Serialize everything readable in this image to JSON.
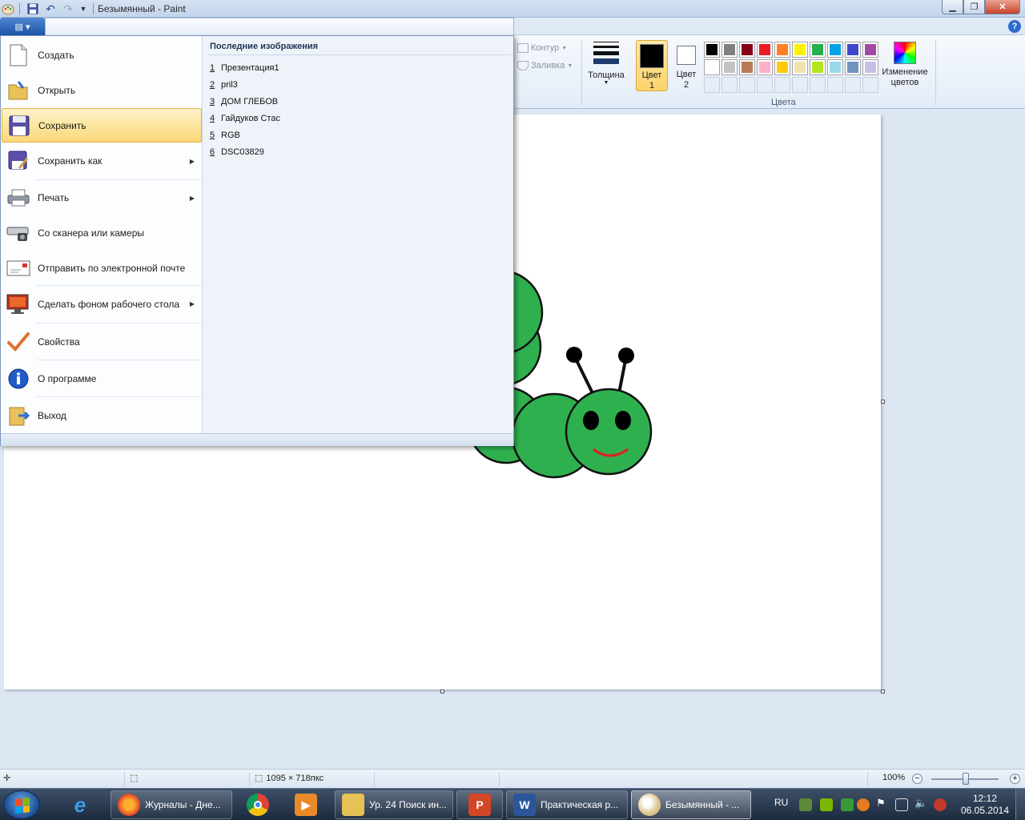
{
  "window": {
    "title": "Безымянный - Paint",
    "controls": [
      "minimize",
      "maximize",
      "close"
    ]
  },
  "ribbon": {
    "outline_label": "Контур",
    "fill_label": "Заливка",
    "thickness_label": "Толщина",
    "color1_label_line1": "Цвет",
    "color1_label_line2": "1",
    "color2_label_line1": "Цвет",
    "color2_label_line2": "2",
    "color1_value": "#000000",
    "color2_value": "#ffffff",
    "colors_group_label": "Цвета",
    "edit_colors_line1": "Изменение",
    "edit_colors_line2": "цветов",
    "palette": [
      "#000000",
      "#7f7f7f",
      "#880015",
      "#ed1c24",
      "#ff7f27",
      "#fff200",
      "#22b14c",
      "#00a2e8",
      "#3f48cc",
      "#a349a4",
      "#ffffff",
      "#c3c3c3",
      "#b97a57",
      "#ffaec9",
      "#ffc90e",
      "#efe4b0",
      "#b5e61d",
      "#99d9ea",
      "#7092be",
      "#c8bfe7",
      "",
      "",
      "",
      "",
      "",
      "",
      "",
      "",
      "",
      ""
    ]
  },
  "file_menu": {
    "items": [
      {
        "label": "Создать",
        "icon": "new-document-icon"
      },
      {
        "label": "Открыть",
        "icon": "open-folder-icon"
      },
      {
        "label": "Сохранить",
        "icon": "save-disk-icon"
      },
      {
        "label": "Сохранить как",
        "icon": "save-as-icon"
      },
      {
        "label": "Печать",
        "icon": "printer-icon"
      },
      {
        "label": "Со сканера или камеры",
        "icon": "scanner-icon"
      },
      {
        "label": "Отправить по электронной почте",
        "icon": "email-icon"
      },
      {
        "label": "Сделать фоном рабочего стола",
        "icon": "desktop-background-icon"
      },
      {
        "label": "Свойства",
        "icon": "checkmark-icon"
      },
      {
        "label": "О программе",
        "icon": "info-icon"
      },
      {
        "label": "Выход",
        "icon": "exit-icon"
      }
    ],
    "recent_title": "Последние изображения",
    "recent": [
      {
        "num": "1",
        "name": "Презентация1"
      },
      {
        "num": "2",
        "name": "pril3"
      },
      {
        "num": "3",
        "name": "ДОМ ГЛЕБОВ"
      },
      {
        "num": "4",
        "name": "Гайдуков Стас"
      },
      {
        "num": "5",
        "name": "RGB"
      },
      {
        "num": "6",
        "name": "DSC03829"
      }
    ]
  },
  "statusbar": {
    "image_size": "1095 × 718пкс",
    "zoom": "100%",
    "zoom_minus": "−",
    "zoom_plus": "+"
  },
  "taskbar": {
    "items": [
      {
        "label": "",
        "icon": "internet-explorer-icon"
      },
      {
        "label": "Журналы - Дне...",
        "icon": "firefox-icon"
      },
      {
        "label": "",
        "icon": "chrome-icon"
      },
      {
        "label": "",
        "icon": "media-player-icon"
      },
      {
        "label": "Ур. 24 Поиск ин...",
        "icon": "folder-icon"
      },
      {
        "label": "",
        "icon": "powerpoint-icon"
      },
      {
        "label": "Практическая р...",
        "icon": "word-icon"
      },
      {
        "label": "Безымянный - ...",
        "icon": "paint-icon"
      }
    ],
    "language": "RU",
    "time": "12:12",
    "date": "06.05.2014"
  }
}
